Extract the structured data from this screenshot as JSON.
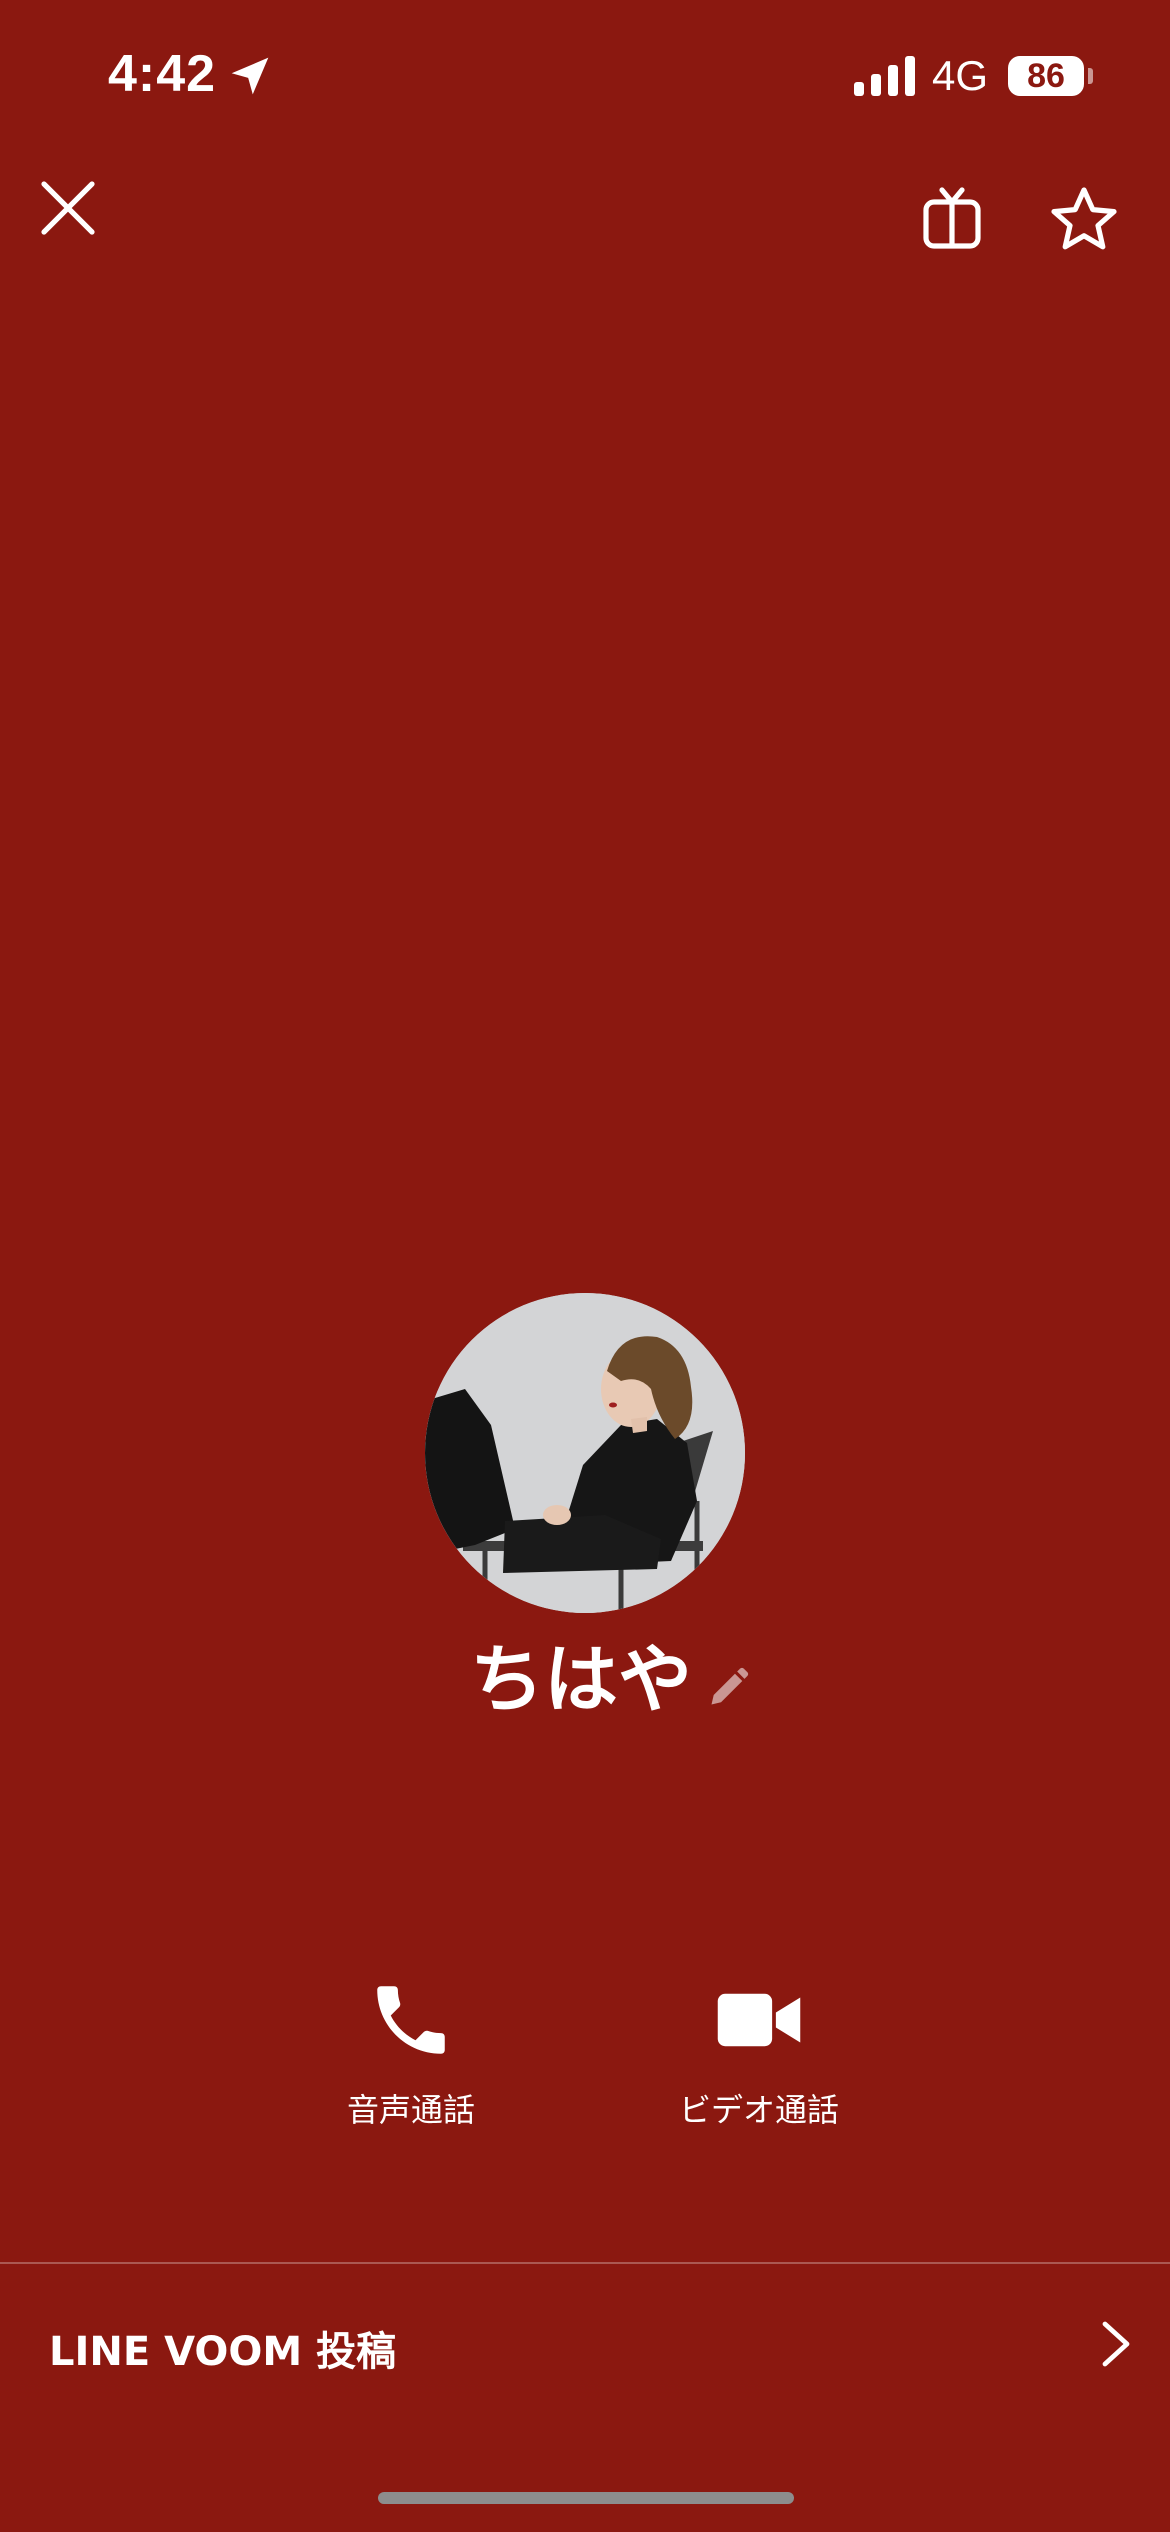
{
  "status_bar": {
    "time": "4:42",
    "network": "4G",
    "battery": "86",
    "location_icon": "location-arrow-icon",
    "signal_icon": "cellular-signal-icon"
  },
  "top_bar": {
    "close_icon": "close-icon",
    "gift_icon": "gift-icon",
    "favorite_icon": "star-icon"
  },
  "profile": {
    "name": "ちはや",
    "edit_icon": "pencil-icon"
  },
  "actions": [
    {
      "label": "音声通話",
      "icon": "phone-icon"
    },
    {
      "label": "ビデオ通話",
      "icon": "video-camera-icon"
    }
  ],
  "voom": {
    "label": "LINE VOOM 投稿",
    "chevron_icon": "chevron-right-icon"
  },
  "colors": {
    "background": "#8b1810",
    "foreground": "#ffffff"
  }
}
